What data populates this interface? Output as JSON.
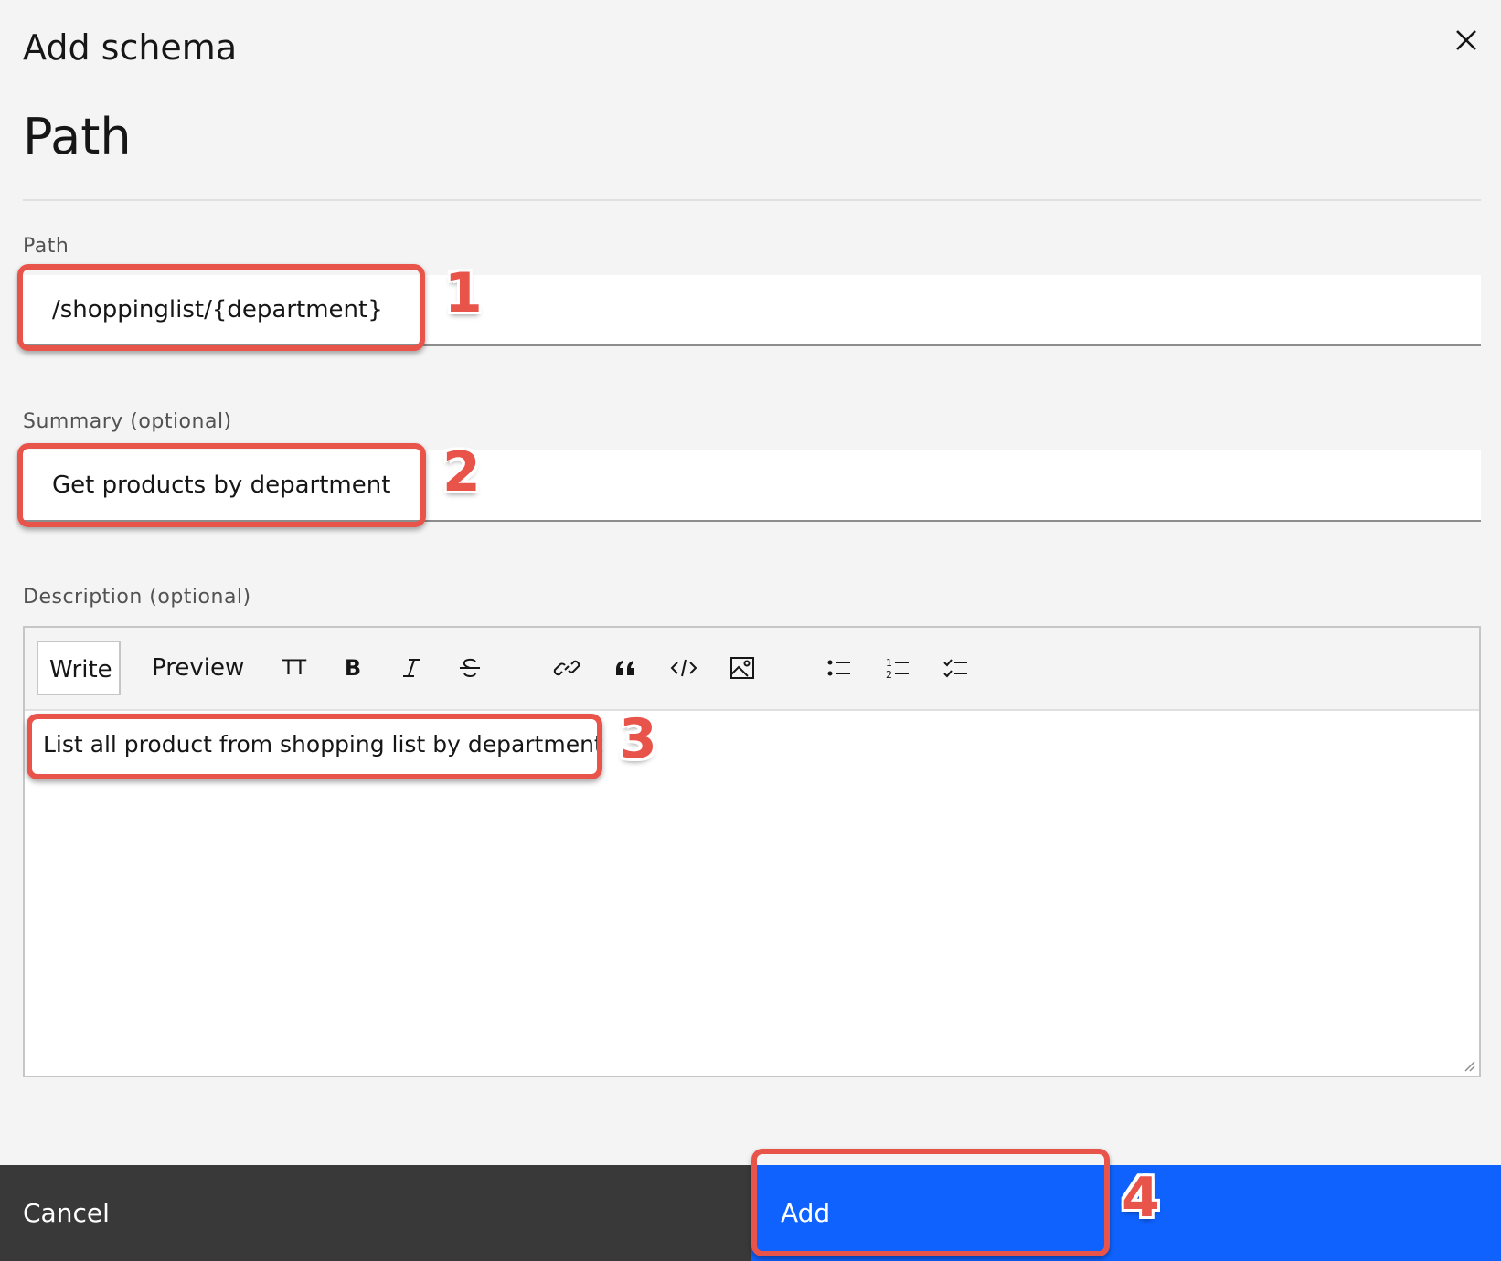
{
  "modal": {
    "label": "Add schema",
    "heading": "Path",
    "close_icon": "close-icon"
  },
  "form": {
    "path": {
      "label": "Path",
      "value": "/shoppinglist/{department}"
    },
    "summary": {
      "label": "Summary (optional)",
      "value": "Get products by department"
    },
    "description": {
      "label": "Description (optional)",
      "tabs": [
        "Write",
        "Preview"
      ],
      "active_tab": "Write",
      "toolbar_icons": [
        "text-size-icon",
        "bold-icon",
        "italic-icon",
        "strikethrough-icon",
        "link-icon",
        "quote-icon",
        "code-icon",
        "image-icon",
        "bulleted-list-icon",
        "numbered-list-icon",
        "task-list-icon"
      ],
      "header_glyph": "TT",
      "bold_glyph": "B",
      "value": "List all product from shopping list by department"
    }
  },
  "footer": {
    "cancel_label": "Cancel",
    "add_label": "Add"
  },
  "callouts": [
    "1",
    "2",
    "3",
    "4"
  ],
  "colors": {
    "primary": "#0f62fe",
    "secondary": "#393939",
    "callout": "#e8534a",
    "background": "#f4f4f4"
  }
}
